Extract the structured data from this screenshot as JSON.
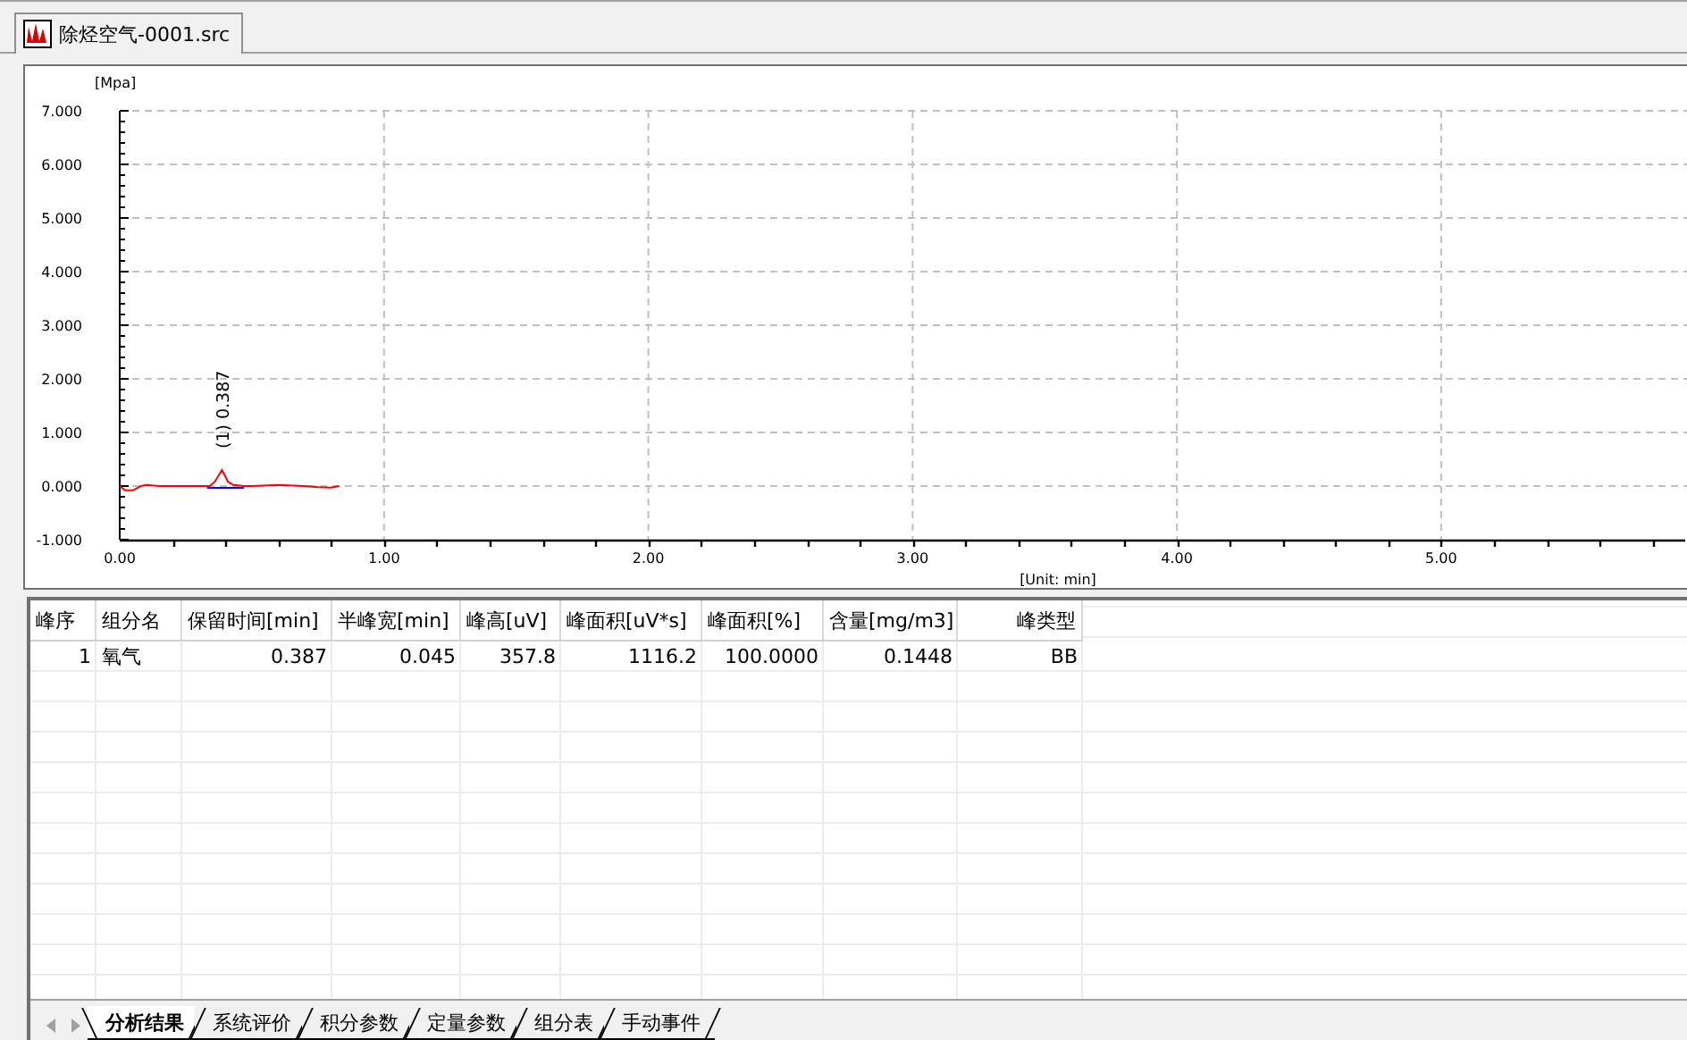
{
  "document_tab": {
    "title": "除烃空气-0001.src",
    "selected": true
  },
  "chart": {
    "chart_data": {
      "type": "line",
      "ylabel": "[Mpa]",
      "xlabel": "[Unit: min]",
      "xlim": [
        0,
        5.93
      ],
      "ylim": [
        -1,
        7
      ],
      "xticks": [
        {
          "value": 0,
          "label": "0.00"
        },
        {
          "value": 1,
          "label": "1.00"
        },
        {
          "value": 2,
          "label": "2.00"
        },
        {
          "value": 3,
          "label": "3.00"
        },
        {
          "value": 4,
          "label": "4.00"
        },
        {
          "value": 5,
          "label": "5.00"
        }
      ],
      "yticks": [
        {
          "value": -1,
          "label": "-1.000"
        },
        {
          "value": 0,
          "label": "0.000"
        },
        {
          "value": 1,
          "label": "1.000"
        },
        {
          "value": 2,
          "label": "2.000"
        },
        {
          "value": 3,
          "label": "3.000"
        },
        {
          "value": 4,
          "label": "4.000"
        },
        {
          "value": 5,
          "label": "5.000"
        },
        {
          "value": 6,
          "label": "6.000"
        },
        {
          "value": 7,
          "label": "7.000"
        }
      ],
      "x": [
        0,
        0.02,
        0.05,
        0.08,
        0.1,
        0.15,
        0.2,
        0.3,
        0.34,
        0.36,
        0.387,
        0.41,
        0.43,
        0.47,
        0.5,
        0.6,
        0.7,
        0.75,
        0.8,
        0.83
      ],
      "grid": true,
      "series": [
        {
          "color": "#ff0000",
          "values": [
            0,
            -0.08,
            -0.08,
            0,
            0.02,
            0,
            0,
            0,
            0,
            0.08,
            0.3,
            0.08,
            0.02,
            0,
            0,
            0.02,
            0,
            -0.02,
            -0.03,
            0
          ]
        }
      ],
      "annotations": [
        "(1) 0.387"
      ]
    }
  },
  "table": {
    "columns": [
      "峰序",
      "组分名",
      "保留时间[min]",
      "半峰宽[min]",
      "峰高[uV]",
      "峰面积[uV*s]",
      "峰面积[%]",
      "含量[mg/m3]",
      "峰类型"
    ],
    "rows": [
      [
        "1",
        "氧气",
        "0.387",
        "0.045",
        "357.8",
        "1116.2",
        "100.0000",
        "0.1448",
        "BB"
      ]
    ]
  },
  "bottom_tabs": [
    {
      "label": "分析结果",
      "selected": true
    },
    {
      "label": "系统评价",
      "selected": false
    },
    {
      "label": "积分参数",
      "selected": false
    },
    {
      "label": "定量参数",
      "selected": false
    },
    {
      "label": "组分表",
      "selected": false
    },
    {
      "label": "手动事件",
      "selected": false
    }
  ]
}
